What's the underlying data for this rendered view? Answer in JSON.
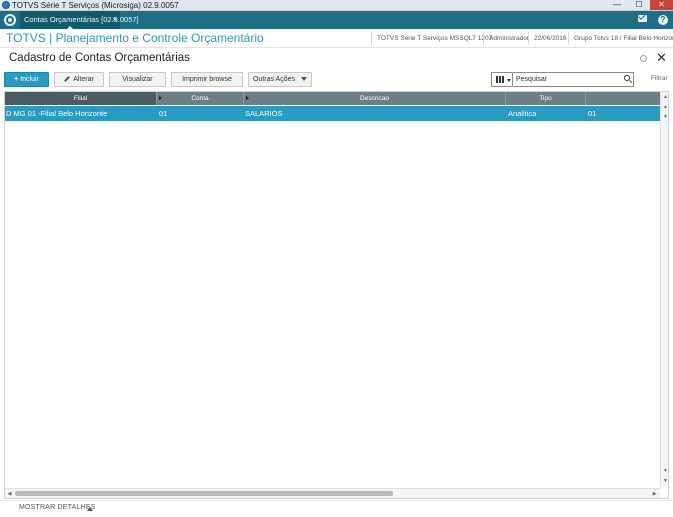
{
  "window": {
    "title": "TOTVS Série T Serviços (Microsiga) 02.9.0057",
    "minimize_glyph": "—",
    "maximize_glyph": "☐",
    "close_glyph": "✕"
  },
  "appbar": {
    "tab_label": "Contas Orçamentárias [02.9.0057]",
    "tab_close": "×",
    "help_glyph": "?"
  },
  "header": {
    "brand": "TOTVS | Planejamento e Controle Orçamentário",
    "environment": "TOTVS Série T Serviços MSSQL7 1207",
    "user": "Administrador",
    "date": "22/06/2016",
    "branch": "Grupo Totvs 18 / Filial Belo Horizonte"
  },
  "page": {
    "title": "Cadastro de Contas Orçamentárias",
    "close_glyph": "✕"
  },
  "toolbar": {
    "include": "Incluir",
    "include_plus": "+",
    "alter": "Alterar",
    "view": "Visualizar",
    "print": "Imprimir browse",
    "other": "Outras Ações"
  },
  "search": {
    "placeholder": "Pesquisar",
    "filter_label": "Filtrar"
  },
  "grid": {
    "columns": [
      "Filial",
      "Conta",
      "Descricao",
      "Tipo",
      ""
    ],
    "rows": [
      [
        "D MG 01 -Filial Belo Horizonte",
        "01",
        "SALARIOS",
        "Analitica",
        "01"
      ]
    ]
  },
  "footer": {
    "details_label": "MOSTRAR DETALHES"
  },
  "colors": {
    "appbar": "#1e6f83",
    "brand": "#2a9bb6",
    "selected_row": "#2a9bc0",
    "grid_header": "#6e7e85"
  }
}
